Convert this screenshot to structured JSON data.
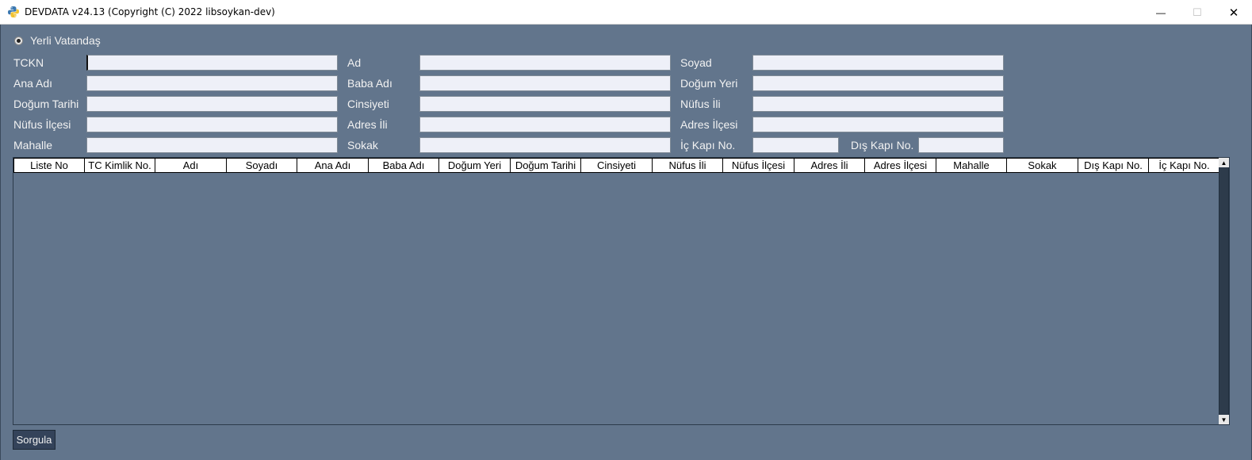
{
  "window": {
    "title": "DEVDATA v24.13 (Copyright (C) 2022 libsoykan-dev)",
    "minimize_glyph": "—",
    "maximize_glyph": "☐",
    "close_glyph": "✕"
  },
  "citizen_type": {
    "label": "Yerli Vatandaş",
    "selected": true
  },
  "form": {
    "tckn": {
      "label": "TCKN",
      "value": ""
    },
    "ad": {
      "label": "Ad",
      "value": ""
    },
    "soyad": {
      "label": "Soyad",
      "value": ""
    },
    "ana_adi": {
      "label": "Ana Adı",
      "value": ""
    },
    "baba_adi": {
      "label": "Baba Adı",
      "value": ""
    },
    "dogum_yeri": {
      "label": "Doğum Yeri",
      "value": ""
    },
    "dogum_tarihi": {
      "label": "Doğum Tarihi",
      "value": ""
    },
    "cinsiyeti": {
      "label": "Cinsiyeti",
      "value": ""
    },
    "nufus_ili": {
      "label": "Nüfus İli",
      "value": ""
    },
    "nufus_ilcesi": {
      "label": "Nüfus İlçesi",
      "value": ""
    },
    "adres_ili": {
      "label": "Adres İli",
      "value": ""
    },
    "adres_ilcesi": {
      "label": "Adres İlçesi",
      "value": ""
    },
    "mahalle": {
      "label": "Mahalle",
      "value": ""
    },
    "sokak": {
      "label": "Sokak",
      "value": ""
    },
    "ic_kapi_no": {
      "label": "İç Kapı No.",
      "value": ""
    },
    "dis_kapi_no": {
      "label": "Dış Kapı No.",
      "value": ""
    }
  },
  "table": {
    "columns": [
      "Liste No",
      "TC Kimlik No.",
      "Adı",
      "Soyadı",
      "Ana Adı",
      "Baba Adı",
      "Doğum Yeri",
      "Doğum Tarihi",
      "Cinsiyeti",
      "Nüfus İli",
      "Nüfus İlçesi",
      "Adres İli",
      "Adres İlçesi",
      "Mahalle",
      "Sokak",
      "Dış Kapı No.",
      "İç Kapı No."
    ],
    "rows": []
  },
  "actions": {
    "query_label": "Sorgula"
  },
  "colors": {
    "background": "#62758c",
    "input_bg": "#eef0f8",
    "button_bg": "#34435a"
  }
}
